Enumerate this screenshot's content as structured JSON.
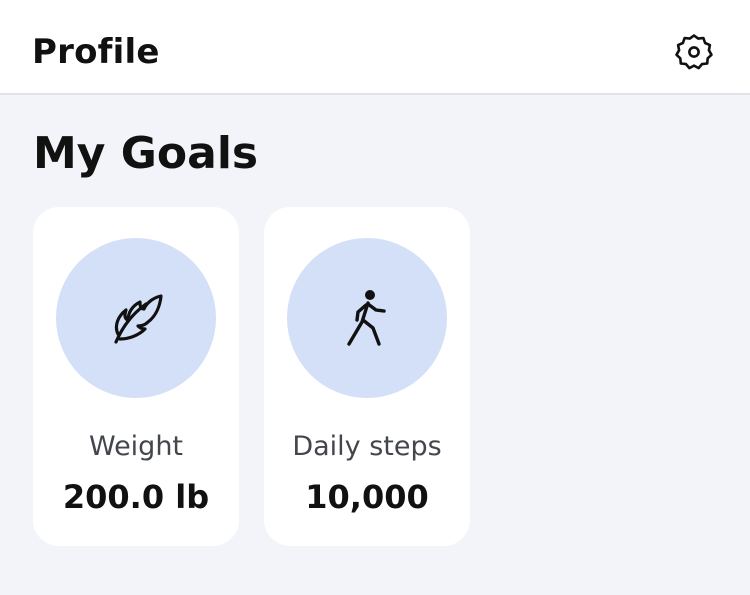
{
  "header": {
    "title": "Profile",
    "settings_icon": "gear-icon"
  },
  "section": {
    "title": "My Goals"
  },
  "goals": [
    {
      "icon": "feather-icon",
      "label": "Weight",
      "value": "200.0 lb"
    },
    {
      "icon": "walking-person-icon",
      "label": "Daily steps",
      "value": "10,000"
    }
  ],
  "colors": {
    "background": "#f3f4f9",
    "card": "#ffffff",
    "icon_circle": "#d4e0f8",
    "text_primary": "#111111",
    "text_secondary": "#44464d"
  }
}
